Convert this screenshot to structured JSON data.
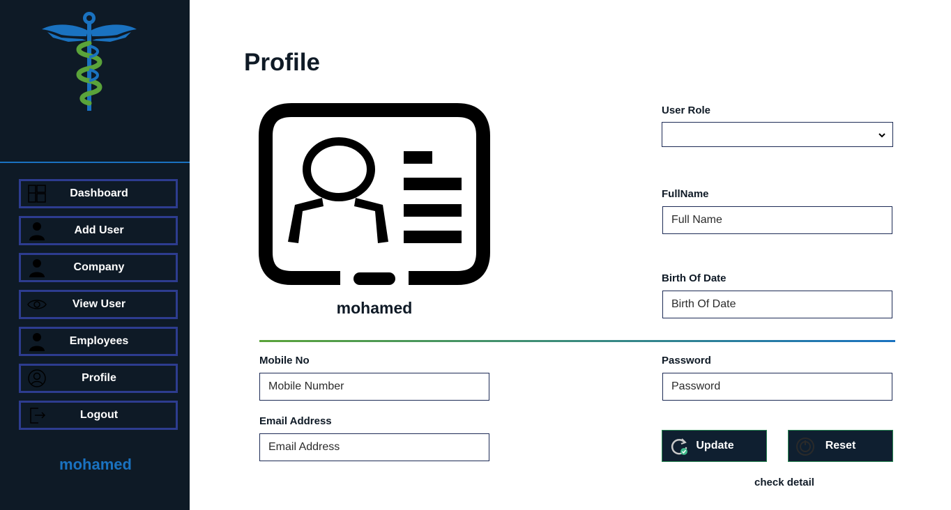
{
  "sidebar": {
    "logo": "caduceus-logo",
    "items": [
      {
        "label": "Dashboard",
        "icon": "dashboard-icon"
      },
      {
        "label": "Add User",
        "icon": "user-icon"
      },
      {
        "label": "Company",
        "icon": "user-icon"
      },
      {
        "label": "View User",
        "icon": "eye-icon"
      },
      {
        "label": "Employees",
        "icon": "user-icon"
      },
      {
        "label": "Profile",
        "icon": "user-circle-icon"
      },
      {
        "label": "Logout",
        "icon": "logout-icon"
      }
    ],
    "username": "mohamed"
  },
  "main": {
    "title": "Profile",
    "profile_name": "mohamed",
    "fields": {
      "user_role": {
        "label": "User Role",
        "value": ""
      },
      "full_name": {
        "label": "FullName",
        "placeholder": "Full Name"
      },
      "birth_date": {
        "label": "Birth Of Date",
        "placeholder": "Birth Of Date"
      },
      "mobile": {
        "label": "Mobile No",
        "placeholder": "Mobile Number"
      },
      "password": {
        "label": "Password",
        "placeholder": "Password"
      },
      "email": {
        "label": "Email Address",
        "placeholder": "Email Address"
      }
    },
    "buttons": {
      "update": "Update",
      "reset": "Reset"
    },
    "check_detail": "check detail"
  },
  "colors": {
    "sidebar_bg": "#0e1a26",
    "accent_blue": "#1a72c0",
    "nav_border": "#2d3c8f",
    "gradient_start": "#5aa33a",
    "gradient_end": "#1a72c0",
    "button_bg": "#0f1f30"
  }
}
